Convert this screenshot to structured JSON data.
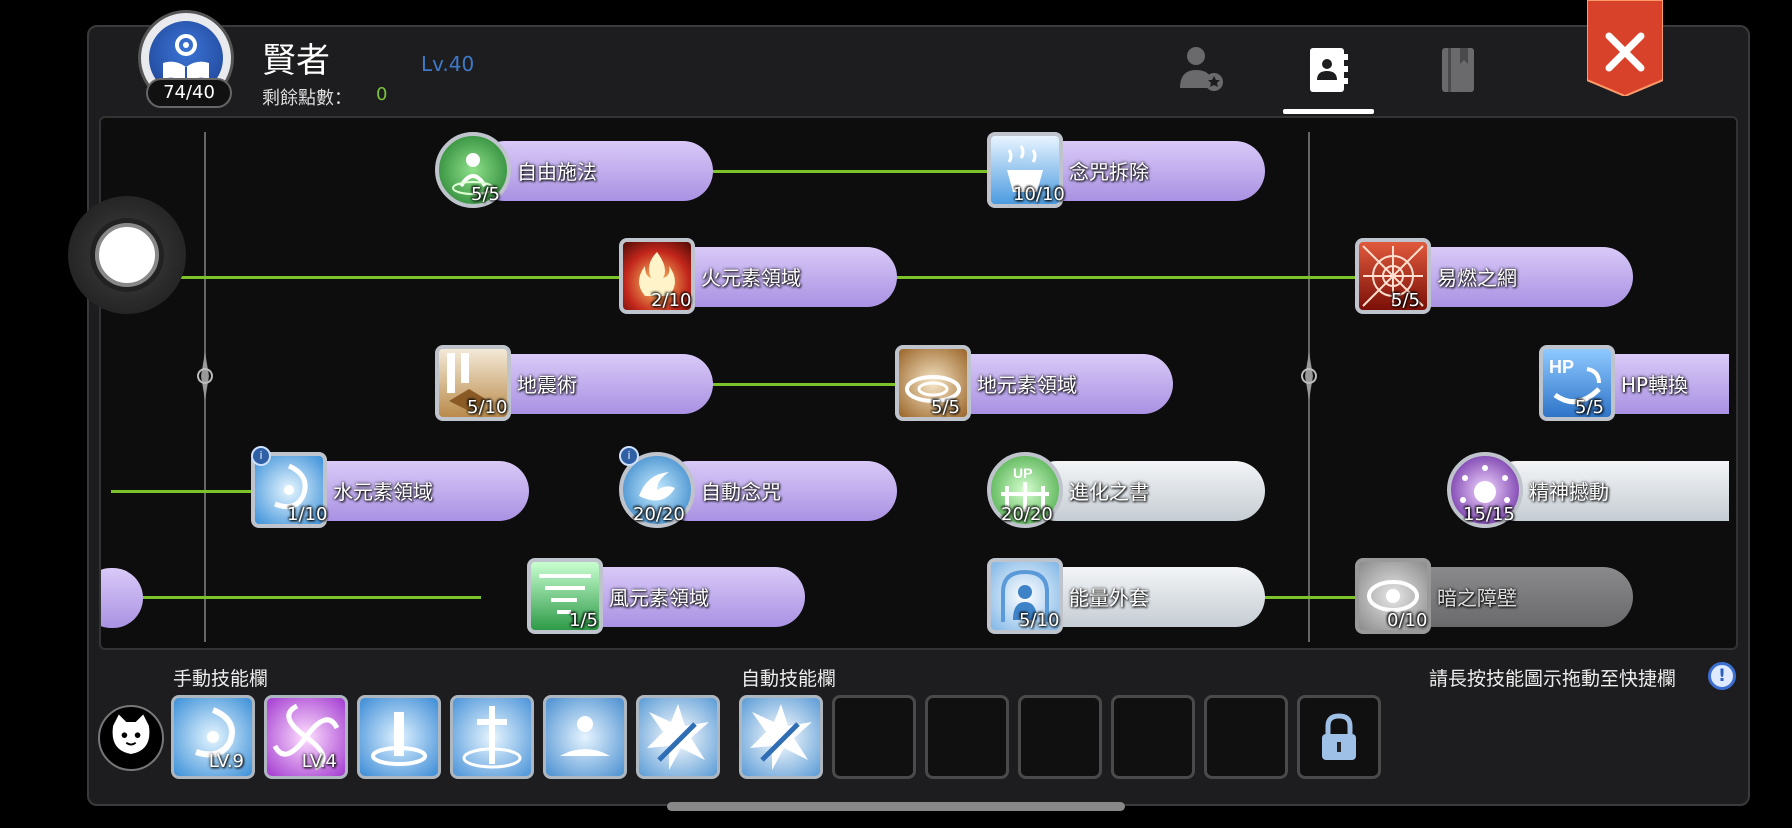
{
  "header": {
    "job_name": "賢者",
    "level": "Lv.40",
    "points_label": "剩餘點數：",
    "points_value": "0",
    "job_progress": "74/40",
    "tabs": [
      "person-star-icon",
      "skill-book-contact-icon",
      "closed-book-icon"
    ],
    "active_tab": 1,
    "close_icon": "close-x-icon"
  },
  "skills": [
    {
      "id": "free-cast",
      "name": "自由施法",
      "level": "5/5",
      "icon": "free-cast-icon",
      "style": "purple"
    },
    {
      "id": "dispel",
      "name": "念咒拆除",
      "level": "10/10",
      "icon": "dispel-icon",
      "style": "purple"
    },
    {
      "id": "fire-zone",
      "name": "火元素領域",
      "level": "2/10",
      "icon": "fire-icon",
      "style": "purple"
    },
    {
      "id": "flammable-web",
      "name": "易燃之網",
      "level": "5/5",
      "icon": "spider-web-icon",
      "style": "purple"
    },
    {
      "id": "earthquake",
      "name": "地震術",
      "level": "5/10",
      "icon": "earthquake-icon",
      "style": "purple"
    },
    {
      "id": "earth-zone",
      "name": "地元素領域",
      "level": "5/5",
      "icon": "earth-ring-icon",
      "style": "purple"
    },
    {
      "id": "hp-convert",
      "name": "HP轉換",
      "level": "5/5",
      "icon": "hp-convert-icon",
      "style": "purple",
      "icon_text": "HP"
    },
    {
      "id": "water-zone",
      "name": "水元素領域",
      "level": "1/10",
      "icon": "water-swirl-icon",
      "style": "purple"
    },
    {
      "id": "auto-chant",
      "name": "自動念咒",
      "level": "20/20",
      "icon": "auto-chant-icon",
      "style": "purple"
    },
    {
      "id": "evolution-book",
      "name": "進化之書",
      "level": "20/20",
      "icon": "evolution-book-icon",
      "style": "white",
      "icon_text": "UP"
    },
    {
      "id": "mind-shock",
      "name": "精神撼動",
      "level": "15/15",
      "icon": "mind-shock-icon",
      "style": "white"
    },
    {
      "id": "wind-zone",
      "name": "風元素領域",
      "level": "1/5",
      "icon": "wind-tornado-icon",
      "style": "purple"
    },
    {
      "id": "energy-coat",
      "name": "能量外套",
      "level": "5/10",
      "icon": "energy-coat-icon",
      "style": "white"
    },
    {
      "id": "dark-barrier",
      "name": "暗之障壁",
      "level": "0/10",
      "icon": "dark-barrier-icon",
      "style": "gray"
    }
  ],
  "bottom": {
    "manual_label": "手動技能欄",
    "auto_label": "自動技能欄",
    "hint": "請長按技能圖示拖動至快捷欄",
    "hint_icon_text": "!",
    "pet_icon": "cat-face-icon",
    "manual_slots": [
      {
        "icon": "water-swirl-icon",
        "level": "LV.9"
      },
      {
        "icon": "purple-vortex-icon",
        "level": "LV.4"
      },
      {
        "icon": "holy-pillar-icon",
        "level": ""
      },
      {
        "icon": "cross-pillar-icon",
        "level": ""
      },
      {
        "icon": "resurrect-icon",
        "level": ""
      },
      {
        "icon": "sword-burst-icon",
        "level": ""
      }
    ],
    "auto_slots": [
      {
        "icon": "sword-burst-icon",
        "state": "filled"
      },
      {
        "icon": "",
        "state": "empty"
      },
      {
        "icon": "",
        "state": "empty"
      },
      {
        "icon": "",
        "state": "empty"
      },
      {
        "icon": "",
        "state": "empty"
      },
      {
        "icon": "",
        "state": "empty"
      },
      {
        "icon": "lock-icon",
        "state": "locked"
      }
    ]
  },
  "colors": {
    "link": "#7cc22a",
    "level_text": "#3d79c6",
    "points_value": "#7bc23b",
    "pill_purple": "#bba7ec",
    "close_red": "#e2452c"
  }
}
